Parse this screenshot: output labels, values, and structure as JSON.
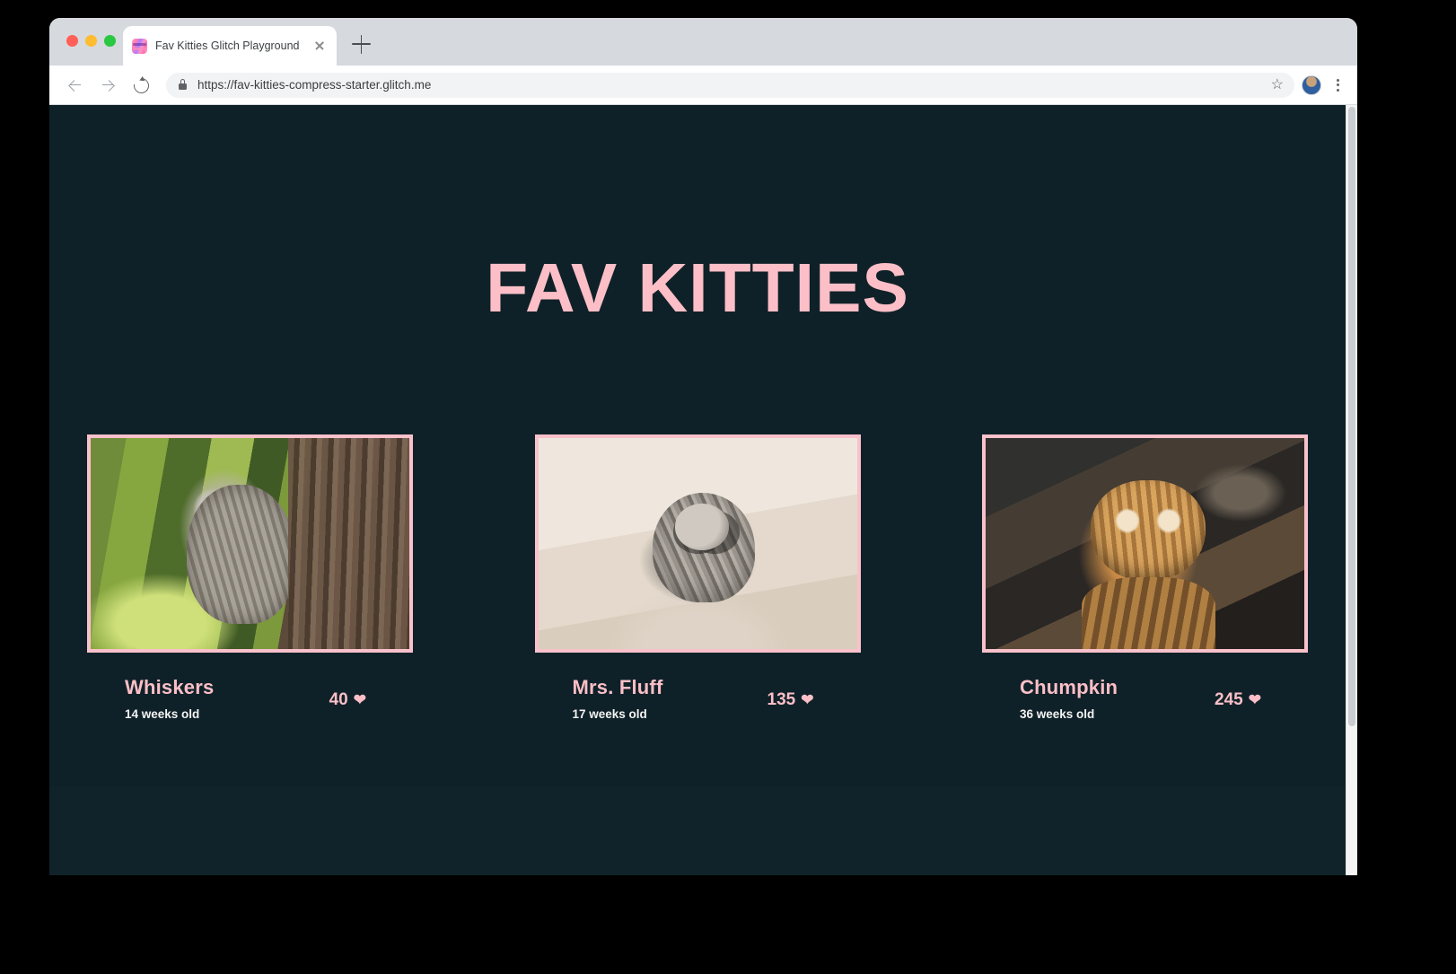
{
  "browser": {
    "tab": {
      "title": "Fav Kitties Glitch Playground",
      "favicon_name": "glitch-favicon",
      "close_label": "×"
    },
    "new_tab_label": "+",
    "toolbar": {
      "back_label": "Back",
      "forward_label": "Forward",
      "reload_label": "Reload",
      "lock_label": "Secure",
      "url": "https://fav-kitties-compress-starter.glitch.me",
      "bookmark_icon": "☆",
      "profile_label": "Profile",
      "menu_label": "More"
    }
  },
  "page": {
    "title": "FAV KITTIES",
    "colors": {
      "background": "#10222a",
      "accent_pink": "#fcbfc7",
      "border_pink": "#f9c1cb",
      "text_light": "#f3f3f3"
    },
    "heart_glyph": "❤",
    "cards": [
      {
        "name": "Whiskers",
        "age": "14 weeks old",
        "likes": "40",
        "image_name": "kitten-photo-whiskers"
      },
      {
        "name": "Mrs. Fluff",
        "age": "17 weeks old",
        "likes": "135",
        "image_name": "kitten-photo-mrs-fluff"
      },
      {
        "name": "Chumpkin",
        "age": "36 weeks old",
        "likes": "245",
        "image_name": "kitten-photo-chumpkin"
      }
    ]
  }
}
